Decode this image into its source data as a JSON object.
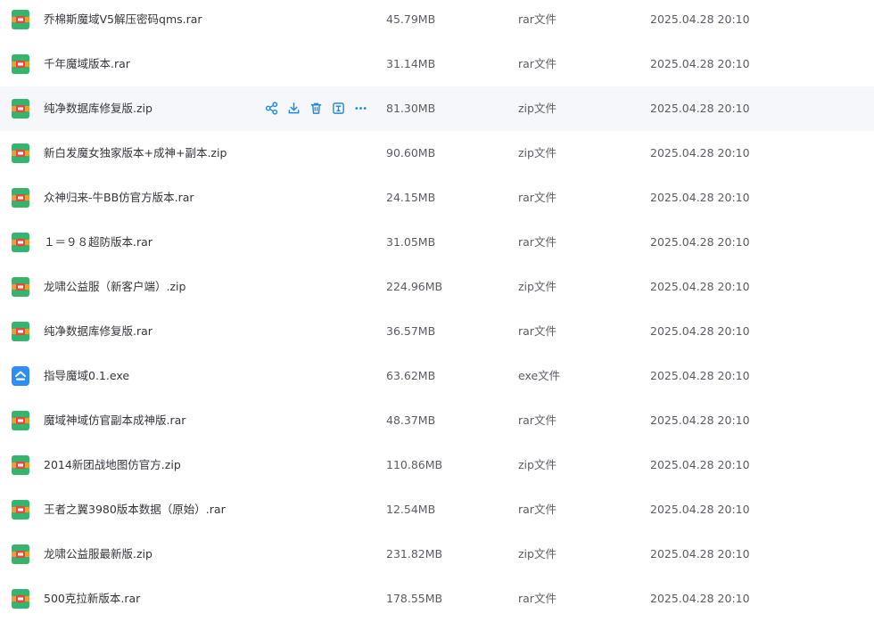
{
  "colors": {
    "action_blue": "#1e88e5",
    "archive_green": "#35b46e",
    "archive_orange": "#f39b2f",
    "archive_red": "#e8493f",
    "exe_blue": "#2f8df5"
  },
  "hover_actions": [
    {
      "icon": "share-icon"
    },
    {
      "icon": "download-icon"
    },
    {
      "icon": "delete-icon"
    },
    {
      "icon": "rename-icon"
    },
    {
      "icon": "more-icon"
    }
  ],
  "files": [
    {
      "name": "乔棉斯魔域V5解压密码qms.rar",
      "size": "45.79MB",
      "type": "rar文件",
      "date": "2025.04.28 20:10",
      "icon": "archive-icon",
      "hovered": false
    },
    {
      "name": "千年魔域版本.rar",
      "size": "31.14MB",
      "type": "rar文件",
      "date": "2025.04.28 20:10",
      "icon": "archive-icon",
      "hovered": false
    },
    {
      "name": "纯净数据库修复版.zip",
      "size": "81.30MB",
      "type": "zip文件",
      "date": "2025.04.28 20:10",
      "icon": "archive-icon",
      "hovered": true
    },
    {
      "name": "新白发魔女独家版本+成神+副本.zip",
      "size": "90.60MB",
      "type": "zip文件",
      "date": "2025.04.28 20:10",
      "icon": "archive-icon",
      "hovered": false
    },
    {
      "name": "众神归来-牛BB仿官方版本.rar",
      "size": "24.15MB",
      "type": "rar文件",
      "date": "2025.04.28 20:10",
      "icon": "archive-icon",
      "hovered": false
    },
    {
      "name": "１＝９８超防版本.rar",
      "size": "31.05MB",
      "type": "rar文件",
      "date": "2025.04.28 20:10",
      "icon": "archive-icon",
      "hovered": false
    },
    {
      "name": "龙啸公益服（新客户端）.zip",
      "size": "224.96MB",
      "type": "zip文件",
      "date": "2025.04.28 20:10",
      "icon": "archive-icon",
      "hovered": false
    },
    {
      "name": "纯净数据库修复版.rar",
      "size": "36.57MB",
      "type": "rar文件",
      "date": "2025.04.28 20:10",
      "icon": "archive-icon",
      "hovered": false
    },
    {
      "name": "指导魔域0.1.exe",
      "size": "63.62MB",
      "type": "exe文件",
      "date": "2025.04.28 20:10",
      "icon": "exe-icon",
      "hovered": false
    },
    {
      "name": "魔域神域仿官副本成神版.rar",
      "size": "48.37MB",
      "type": "rar文件",
      "date": "2025.04.28 20:10",
      "icon": "archive-icon",
      "hovered": false
    },
    {
      "name": "2014新团战地图仿官方.zip",
      "size": "110.86MB",
      "type": "zip文件",
      "date": "2025.04.28 20:10",
      "icon": "archive-icon",
      "hovered": false
    },
    {
      "name": "王者之翼3980版本数据（原始）.rar",
      "size": "12.54MB",
      "type": "rar文件",
      "date": "2025.04.28 20:10",
      "icon": "archive-icon",
      "hovered": false
    },
    {
      "name": "龙啸公益服最新版.zip",
      "size": "231.82MB",
      "type": "zip文件",
      "date": "2025.04.28 20:10",
      "icon": "archive-icon",
      "hovered": false
    },
    {
      "name": "500克拉新版本.rar",
      "size": "178.55MB",
      "type": "rar文件",
      "date": "2025.04.28 20:10",
      "icon": "archive-icon",
      "hovered": false
    }
  ]
}
